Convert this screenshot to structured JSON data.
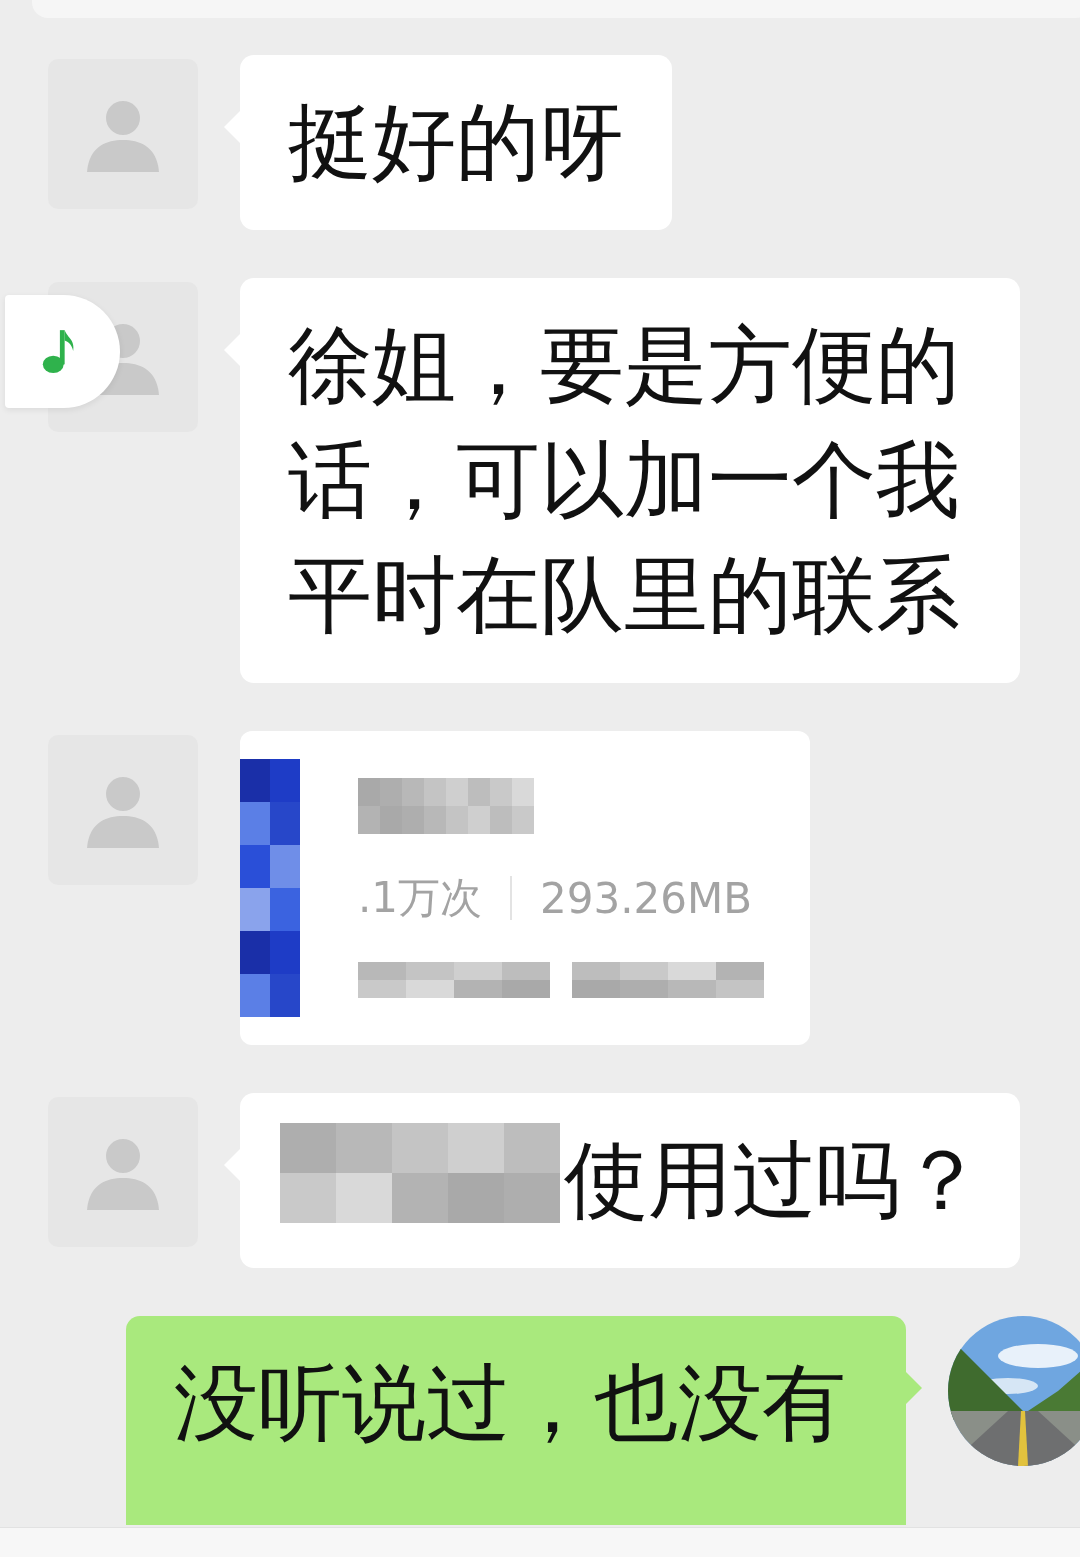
{
  "messages": [
    {
      "kind": "text",
      "outgoing": false,
      "text": "挺好的呀"
    },
    {
      "kind": "text",
      "outgoing": false,
      "text": "徐姐，要是方便的话，可以加一个我平时在队里的联系"
    },
    {
      "kind": "card",
      "outgoing": false,
      "stats": ".1万次",
      "size": "293.26MB"
    },
    {
      "kind": "redacted_text",
      "outgoing": false,
      "text": "使用过吗？"
    },
    {
      "kind": "text",
      "outgoing": true,
      "text": "没听说过，也没有"
    }
  ]
}
